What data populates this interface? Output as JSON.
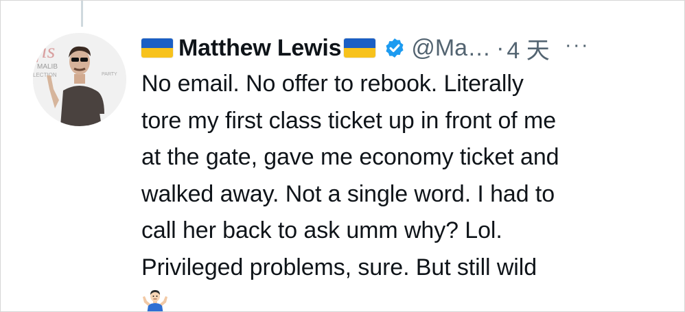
{
  "tweet": {
    "author": {
      "display_name": "Matthew Lewis",
      "flag_icon": "ukraine-flag-icon",
      "verified_icon": "verified-badge-icon",
      "handle": "@Ma…",
      "separator": "·",
      "timestamp": "4 天"
    },
    "more_label": "···",
    "lines": [
      "No email. No offer to rebook. Literally",
      "tore my first class ticket up in front of me",
      "at the gate, gave me economy ticket and",
      "walked away. Not a single word. I had to",
      "call her back to ask umm why? Lol.",
      "Privileged problems, sure. But still wild"
    ],
    "emoji": "man-shrugging-emoji",
    "avatar_text": {
      "line1": "MALIB",
      "line2": "LECTION",
      "line3": "PARTY"
    }
  },
  "colors": {
    "text_primary": "#0f1419",
    "text_secondary": "#536471",
    "verified_blue": "#1d9bf0",
    "flag_blue": "#1b5fc4",
    "flag_yellow": "#f7c21c",
    "thread_line": "#cfd9de"
  }
}
